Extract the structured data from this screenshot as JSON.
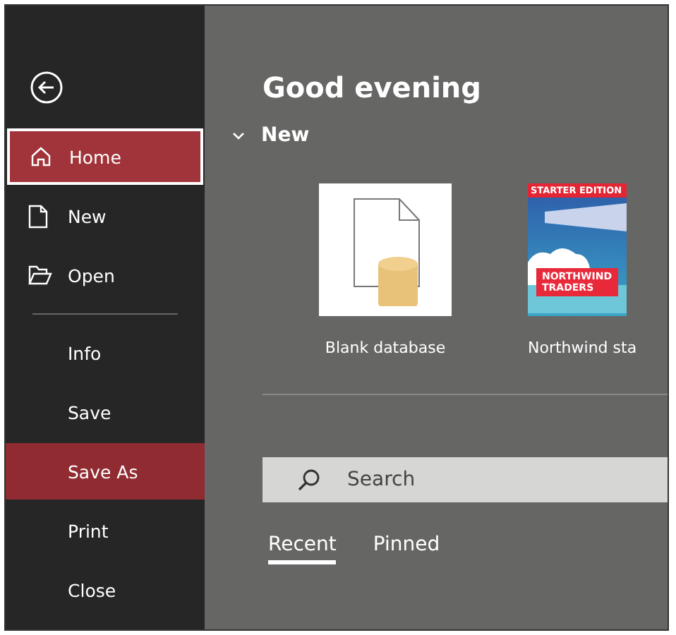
{
  "sidebar": {
    "items": [
      {
        "kind": "home",
        "label": "Home",
        "selected": true,
        "highlighted": false
      },
      {
        "kind": "new",
        "label": "New",
        "selected": false,
        "highlighted": false
      },
      {
        "kind": "open",
        "label": "Open",
        "selected": false,
        "highlighted": false
      },
      {
        "kind": "plain",
        "label": "Info",
        "divider_before": true,
        "selected": false,
        "highlighted": false
      },
      {
        "kind": "plain",
        "label": "Save",
        "selected": false,
        "highlighted": false
      },
      {
        "kind": "plain",
        "label": "Save As",
        "selected": false,
        "highlighted": true
      },
      {
        "kind": "plain",
        "label": "Print",
        "selected": false,
        "highlighted": false
      },
      {
        "kind": "plain",
        "label": "Close",
        "selected": false,
        "highlighted": false
      }
    ]
  },
  "greeting": "Good evening",
  "new_section": {
    "title": "New",
    "expanded": true,
    "templates": [
      {
        "kind": "blank",
        "label": "Blank database"
      },
      {
        "kind": "northwind",
        "label": "Northwind sta",
        "banner": "STARTER EDITION",
        "ribbon": [
          "NORTHWIND",
          "TRADERS"
        ]
      }
    ]
  },
  "search": {
    "placeholder": "Search"
  },
  "tabs": [
    {
      "label": "Recent",
      "selected": true
    },
    {
      "label": "Pinned",
      "selected": false
    }
  ]
}
